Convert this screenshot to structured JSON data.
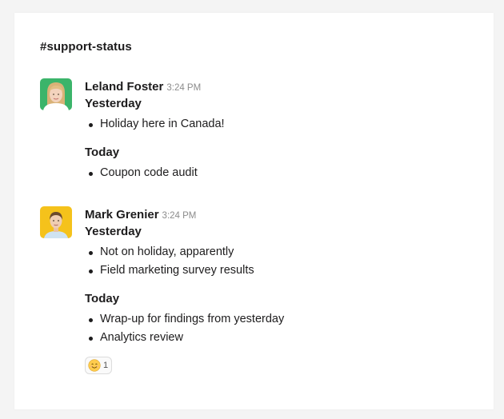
{
  "channel": {
    "name": "#support-status"
  },
  "messages": [
    {
      "author": "Leland Foster",
      "time": "3:24 PM",
      "avatar_bg": "#3bb46a",
      "sections": [
        {
          "heading": "Yesterday",
          "items": [
            "Holiday here in Canada!"
          ]
        },
        {
          "heading": "Today",
          "items": [
            "Coupon code audit"
          ]
        }
      ]
    },
    {
      "author": "Mark Grenier",
      "time": "3:24 PM",
      "avatar_bg": "#f5c21b",
      "sections": [
        {
          "heading": "Yesterday",
          "items": [
            "Not on holiday, apparently",
            "Field marketing survey results"
          ]
        },
        {
          "heading": "Today",
          "items": [
            "Wrap-up for findings from yesterday",
            "Analytics review"
          ]
        }
      ],
      "reaction": {
        "emoji": "smiling-face-emoji",
        "count": "1"
      }
    }
  ],
  "colors": {
    "text": "#1d1c1d",
    "timestamp": "#8c8c8c",
    "background": "#f4f4f4",
    "card": "#ffffff"
  }
}
